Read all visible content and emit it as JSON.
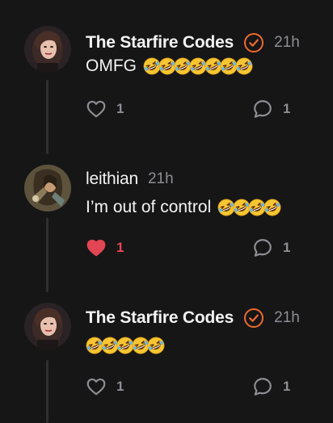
{
  "colors": {
    "background": "#161617",
    "verified_accent": "#ee6a2b",
    "liked_accent": "#e24553",
    "muted_text": "#8e8e93",
    "primary_text": "#f3f3f3"
  },
  "posts": [
    {
      "author": "The Starfire Codes",
      "verified": true,
      "time": "21h",
      "text": "OMFG",
      "emoji_count": 7,
      "emoji_icon": "rolling-on-floor-laughing-emoji",
      "likes": "1",
      "liked": false,
      "replies": "1"
    },
    {
      "author": "leithian",
      "verified": false,
      "time": "21h",
      "text": "I’m out of control",
      "emoji_count": 4,
      "emoji_icon": "rolling-on-floor-laughing-emoji",
      "likes": "1",
      "liked": true,
      "replies": "1"
    },
    {
      "author": "The Starfire Codes",
      "verified": true,
      "time": "21h",
      "text": "",
      "emoji_count": 5,
      "emoji_icon": "rolling-on-floor-laughing-emoji",
      "likes": "1",
      "liked": false,
      "replies": "1"
    }
  ]
}
